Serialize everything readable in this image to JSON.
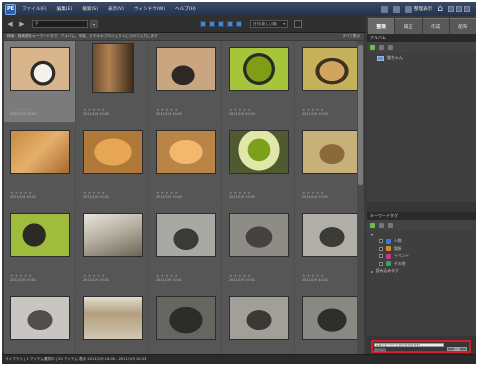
{
  "app": {
    "logo": "PE",
    "menus": [
      "ファイル(F)",
      "編集(E)",
      "検索(S)",
      "表示(V)",
      "ウィンドウ(W)",
      "ヘルプ(H)"
    ],
    "organizer_button": "整理表示",
    "home_icon": "home-icon"
  },
  "toolbar": {
    "search_value": "",
    "sort_label": "日付(新しい順)"
  },
  "tabs": [
    {
      "label": "整理",
      "active": true
    },
    {
      "label": "補正",
      "active": false
    },
    {
      "label": "作成",
      "active": false
    },
    {
      "label": "配布",
      "active": false
    }
  ],
  "browser": {
    "info_text": "検索：検索語をキーワードタグ、アルバム、写真、ビデオのプロジェクトにつけて入力します",
    "show_all": "すべて表示"
  },
  "photos": [
    {
      "date": "2011/1/9 10:03",
      "stars": "★★★★★",
      "sel": true
    },
    {
      "date": "2011/1/9 10:03",
      "stars": "★★★★★"
    },
    {
      "date": "2011/1/9 10:03",
      "stars": "★★★★★"
    },
    {
      "date": "2011/1/9 10:03",
      "stars": "★★★★★"
    },
    {
      "date": "2011/1/9 10:02",
      "stars": "★★★★★"
    },
    {
      "date": "2011/1/9 10:02",
      "stars": "★★★★★"
    },
    {
      "date": "2011/1/9 10:02",
      "stars": "★★★★★"
    },
    {
      "date": "2011/1/9 10:02",
      "stars": "★★★★★"
    },
    {
      "date": "2011/1/9 10:02",
      "stars": "★★★★★"
    },
    {
      "date": "2011/1/9 10:01",
      "stars": "★★★★★"
    },
    {
      "date": "2011/1/9 10:01",
      "stars": "★★★★★"
    },
    {
      "date": "2011/1/9 10:01",
      "stars": "★★★★★"
    },
    {
      "date": "2011/1/9 10:01",
      "stars": "★★★★★"
    },
    {
      "date": "2011/1/9 10:01",
      "stars": "★★★★★"
    },
    {
      "date": "2011/1/9 10:01",
      "stars": "★★★★★"
    },
    {
      "date": "2011/1/9 10:00",
      "stars": "★★★★★"
    },
    {
      "date": "2011/1/9 10:00",
      "stars": "★★★★★"
    },
    {
      "date": "2011/1/9 10:00",
      "stars": "★★★★★"
    },
    {
      "date": "2011/1/9 10:00",
      "stars": "★★★★★"
    },
    {
      "date": "2011/1/9 10:00",
      "stars": "★★★★★"
    }
  ],
  "panel": {
    "album_header": "アルバム",
    "album_item": "猫ちゃん",
    "kw_header": "キーワードタグ",
    "keywords": [
      {
        "label": "人物",
        "color": "#3b7bd4"
      },
      {
        "label": "場所",
        "color": "#d88a2a"
      },
      {
        "label": "イベント",
        "color": "#c23a8a"
      },
      {
        "label": "その他",
        "color": "#3aa05a"
      }
    ],
    "imported": "読み込みタグ",
    "tag_field": "写真にキーワードタグ(を付けます)",
    "tag_label": "選択項目",
    "tag_button": "追加"
  },
  "status": {
    "text": "ライブラリ  |  1 アイテム選択中  |  20 アイテム 表示 2011/1/9 10:00 - 2011/1/9 10:03"
  }
}
